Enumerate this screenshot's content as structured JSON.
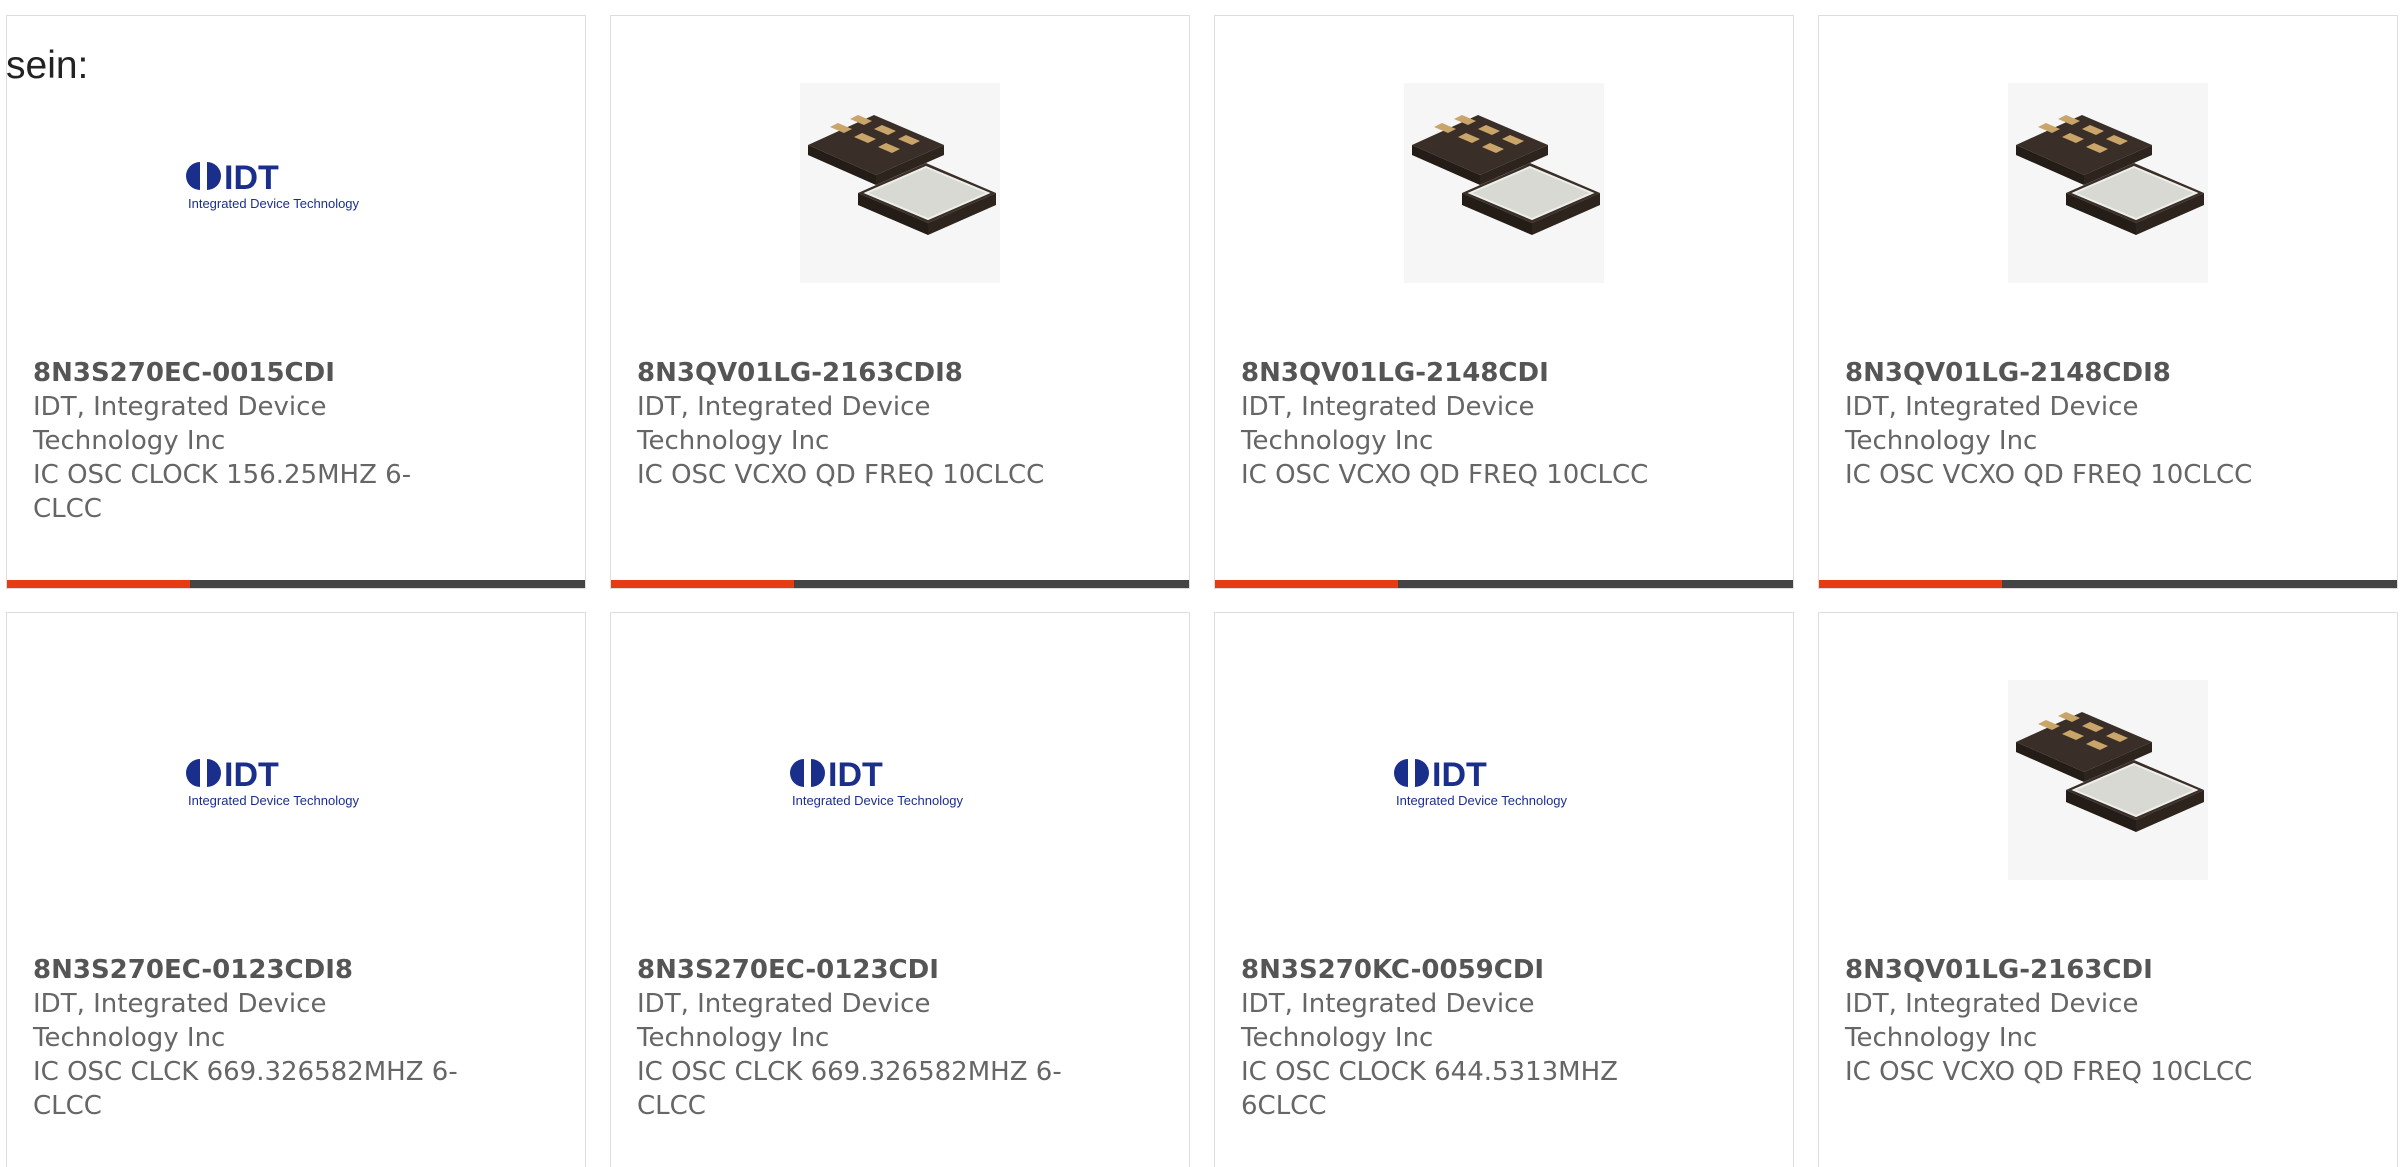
{
  "intro_text": "sein:",
  "colors": {
    "accent": "#e63c14",
    "bar": "#444444",
    "border": "#dddddd",
    "text": "#666666"
  },
  "products": [
    {
      "part": "8N3S270EC-0015CDI",
      "manufacturer": "IDT, Integrated Device Technology Inc",
      "description": "IC OSC CLOCK 156.25MHZ 6-CLCC",
      "image": "idt-logo",
      "logo_text": "IDT",
      "logo_sub": "Integrated Device Technology"
    },
    {
      "part": "8N3QV01LG-2163CDI8",
      "manufacturer": "IDT, Integrated Device Technology Inc",
      "description": "IC OSC VCXO QD FREQ 10CLCC",
      "image": "oscillator-chip"
    },
    {
      "part": "8N3QV01LG-2148CDI",
      "manufacturer": "IDT, Integrated Device Technology Inc",
      "description": "IC OSC VCXO QD FREQ 10CLCC",
      "image": "oscillator-chip"
    },
    {
      "part": "8N3QV01LG-2148CDI8",
      "manufacturer": "IDT, Integrated Device Technology Inc",
      "description": "IC OSC VCXO QD FREQ 10CLCC",
      "image": "oscillator-chip"
    },
    {
      "part": "8N3S270EC-0123CDI8",
      "manufacturer": "IDT, Integrated Device Technology Inc",
      "description": "IC OSC CLCK 669.326582MHZ 6-CLCC",
      "image": "idt-logo",
      "logo_text": "IDT",
      "logo_sub": "Integrated Device Technology"
    },
    {
      "part": "8N3S270EC-0123CDI",
      "manufacturer": "IDT, Integrated Device Technology Inc",
      "description": "IC OSC CLCK 669.326582MHZ 6-CLCC",
      "image": "idt-logo",
      "logo_text": "IDT",
      "logo_sub": "Integrated Device Technology"
    },
    {
      "part": "8N3S270KC-0059CDI",
      "manufacturer": "IDT, Integrated Device Technology Inc",
      "description": "IC OSC CLOCK 644.5313MHZ 6CLCC",
      "image": "idt-logo",
      "logo_text": "IDT",
      "logo_sub": "Integrated Device Technology"
    },
    {
      "part": "8N3QV01LG-2163CDI",
      "manufacturer": "IDT, Integrated Device Technology Inc",
      "description": "IC OSC VCXO QD FREQ 10CLCC",
      "image": "oscillator-chip"
    }
  ]
}
